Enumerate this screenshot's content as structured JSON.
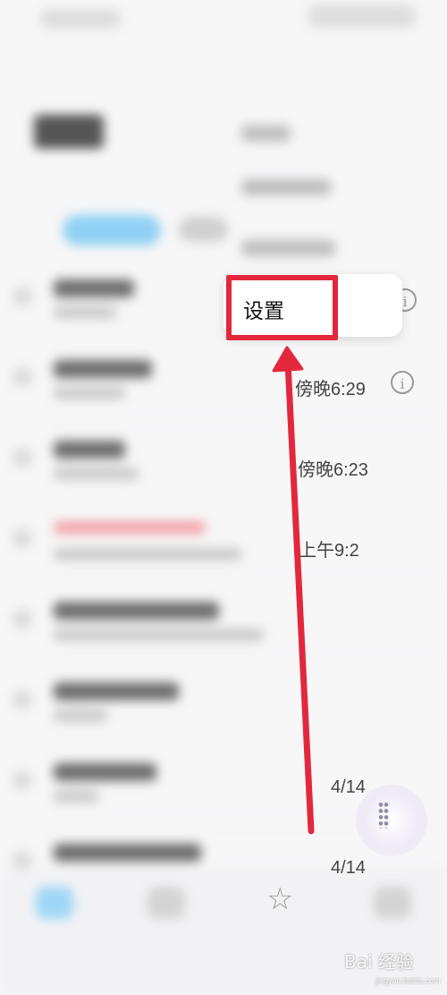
{
  "menu": {
    "settings_label": "设置"
  },
  "messages": [
    {
      "time": "傍晚6:29"
    },
    {
      "time": "傍晚6:23"
    },
    {
      "time": "上午9:2"
    },
    {
      "time": ""
    },
    {
      "time": ""
    },
    {
      "time": "4/14"
    },
    {
      "time": "4/14"
    }
  ],
  "watermark": {
    "text": "Bai 经验",
    "sub": "jingyan.baidu.com"
  },
  "icons": {
    "info": "info-icon",
    "star": "star-icon",
    "fab": "floating-dial-icon"
  },
  "colors": {
    "highlight": "#e3283d",
    "accent_blue": "#8fd0f4"
  }
}
